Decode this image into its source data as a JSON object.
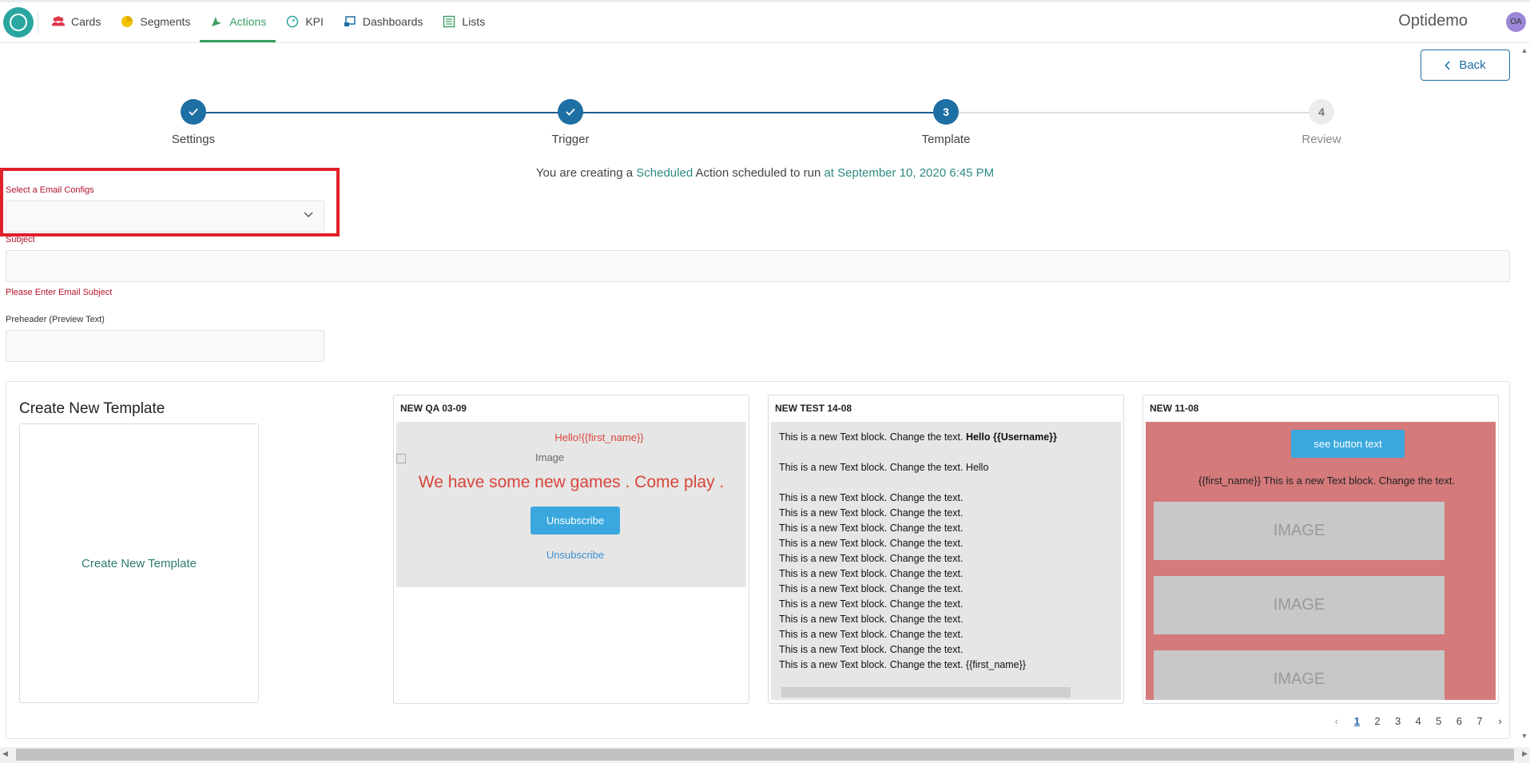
{
  "nav": {
    "items": [
      {
        "label": "Cards",
        "icon": "users-icon",
        "active": false
      },
      {
        "label": "Segments",
        "icon": "pie-chart-icon",
        "active": false
      },
      {
        "label": "Actions",
        "icon": "actions-icon",
        "active": true
      },
      {
        "label": "KPI",
        "icon": "gauge-icon",
        "active": false
      },
      {
        "label": "Dashboards",
        "icon": "dashboard-icon",
        "active": false
      },
      {
        "label": "Lists",
        "icon": "list-icon",
        "active": false
      }
    ],
    "brand": "Optidemo",
    "avatar": "OA"
  },
  "back_label": "Back",
  "steps": [
    {
      "label": "Settings",
      "state": "done",
      "number": ""
    },
    {
      "label": "Trigger",
      "state": "done",
      "number": ""
    },
    {
      "label": "Template",
      "state": "current",
      "number": "3"
    },
    {
      "label": "Review",
      "state": "todo",
      "number": "4"
    }
  ],
  "info": {
    "prefix": "You are creating a",
    "type": "Scheduled",
    "middle": "Action scheduled to run",
    "time": "at September 10, 2020 6:45 PM"
  },
  "form": {
    "email_config_label": "Select a Email Configs",
    "email_config_value": "",
    "subject_label": "Subject",
    "subject_value": "",
    "subject_error": "Please Enter Email Subject",
    "preheader_label": "Preheader (Preview Text)",
    "preheader_value": ""
  },
  "templates": {
    "create_title": "Create New Template",
    "create_card_label": "Create New Template",
    "cards": [
      {
        "title": "NEW QA 03-09",
        "hello": "Hello!{{first_name}}",
        "image_alt": "Image",
        "headline": "We have some new games . Come play .",
        "button": "Unsubscribe",
        "link": "Unsubscribe"
      },
      {
        "title": "NEW TEST 14-08",
        "line1_prefix": "This is a new Text block. Change the text.",
        "line1_bold": "Hello {{Username}}",
        "line2": "This is a new Text block. Change the text. Hello",
        "repeat_line": "This is a new Text block. Change the text.",
        "last_line": "This is a new Text block. Change the text. {{first_name}}"
      },
      {
        "title": "NEW 11-08",
        "button": "see button text",
        "text": "{{first_name}} This is a new Text block. Change the text.",
        "image_labels": [
          "IMAGE",
          "IMAGE",
          "IMAGE"
        ]
      }
    ]
  },
  "pagination": {
    "pages": [
      "1",
      "2",
      "3",
      "4",
      "5",
      "6",
      "7"
    ],
    "current": "1"
  }
}
